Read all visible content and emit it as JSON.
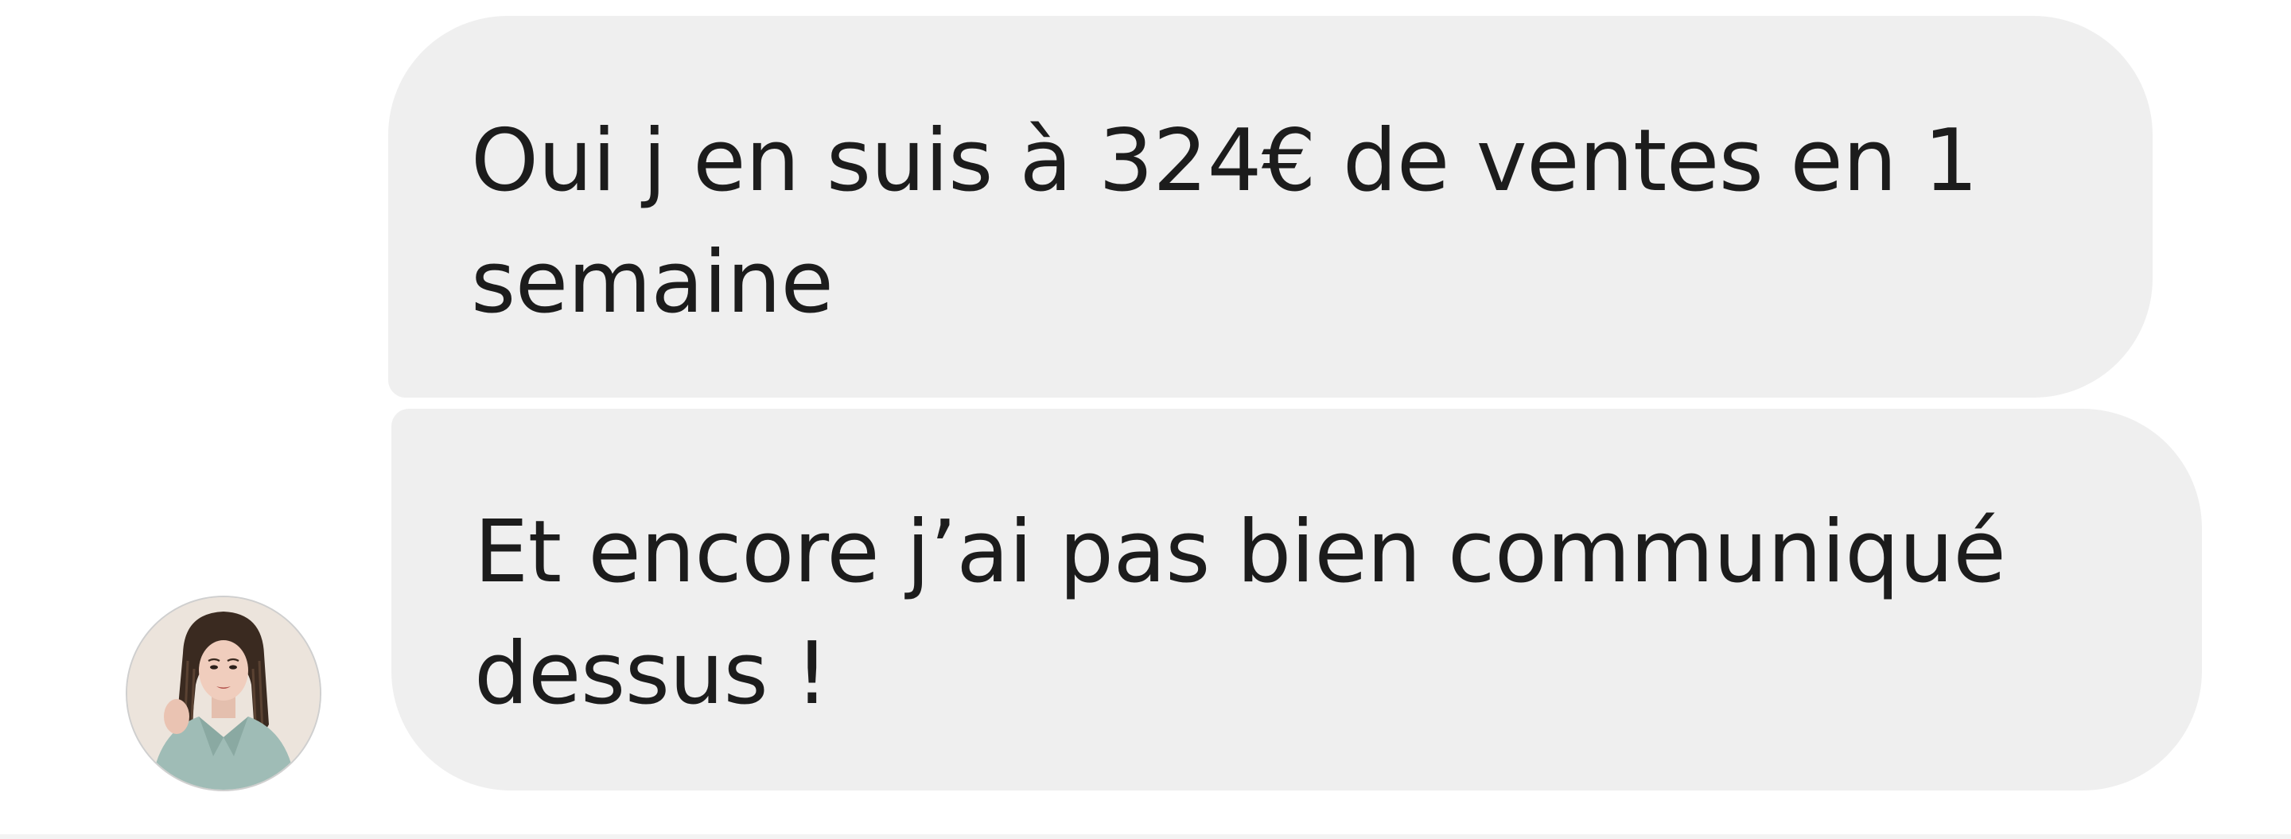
{
  "conversation": {
    "messages": [
      {
        "lines": [
          "Oui j en suis à 324€ de ventes en 1",
          "semaine"
        ]
      },
      {
        "lines": [
          "Et encore j’ai pas bien communiqué",
          "dessus !"
        ]
      }
    ],
    "avatar_icon": "profile-photo-avatar",
    "bubble_color": "#efefef",
    "text_color": "#1c1c1c"
  }
}
